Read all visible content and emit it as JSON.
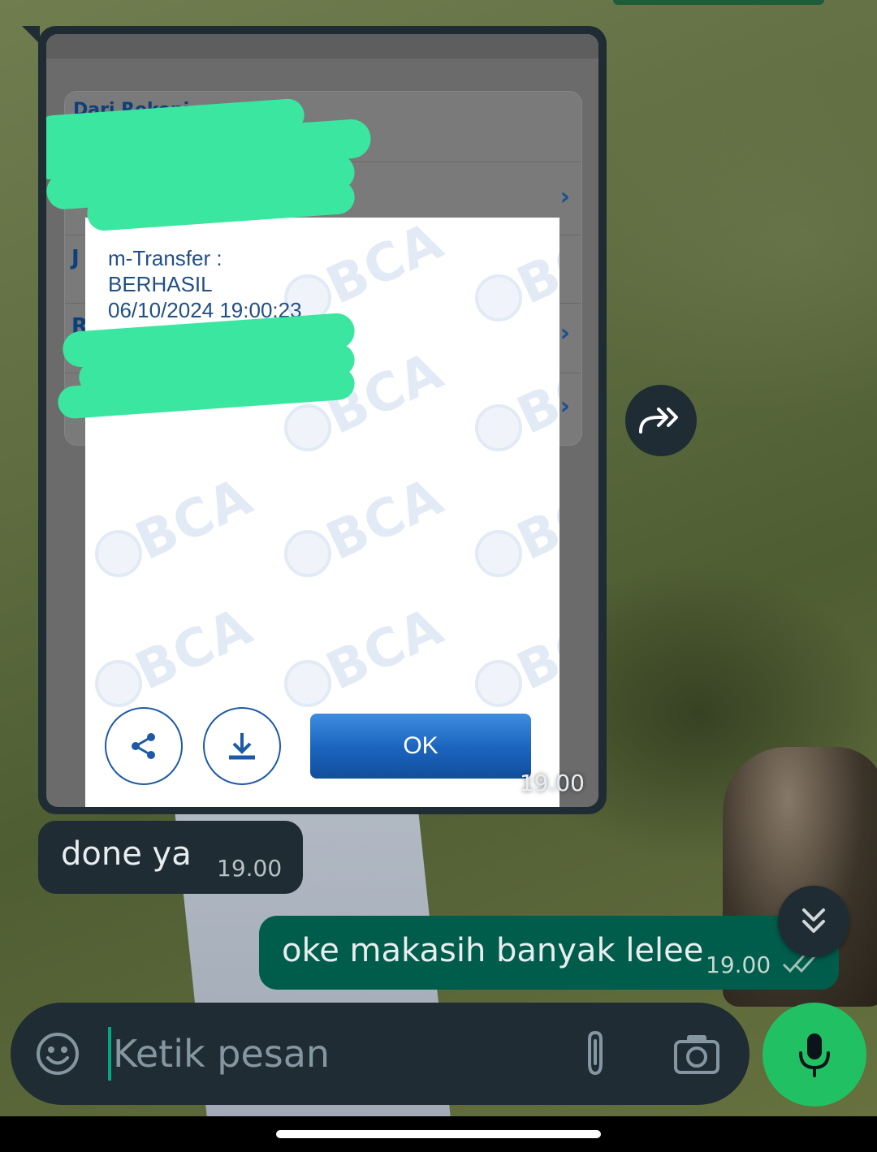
{
  "chat": {
    "image_message": {
      "time": "19.00",
      "screenshot": {
        "header_label": "Dari Rekening:",
        "side_letters": [
          "J",
          "R"
        ],
        "receipt": {
          "lines": [
            "m-Transfer :",
            "BERHASIL",
            "06/10/2024 19:00:23"
          ],
          "watermark": "BCA",
          "ok_label": "OK"
        }
      }
    },
    "incoming_text": {
      "text": "done ya",
      "time": "19.00"
    },
    "outgoing_text": {
      "text": "oke makasih banyak lelee",
      "time": "19.00",
      "status": "read"
    }
  },
  "composer": {
    "placeholder": "Ketik pesan"
  },
  "colors": {
    "incoming_bubble": "#1f2c33",
    "outgoing_bubble": "#005c4b",
    "accent": "#21c063",
    "redaction": "#3be6a0"
  },
  "icons": {
    "forward": "forward-icon",
    "scroll_down": "double-chevron-down-icon",
    "emoji": "emoji-icon",
    "attach": "paperclip-icon",
    "camera": "camera-icon",
    "mic": "mic-icon",
    "share": "share-icon",
    "download": "download-icon",
    "read_receipt": "double-check-icon"
  }
}
